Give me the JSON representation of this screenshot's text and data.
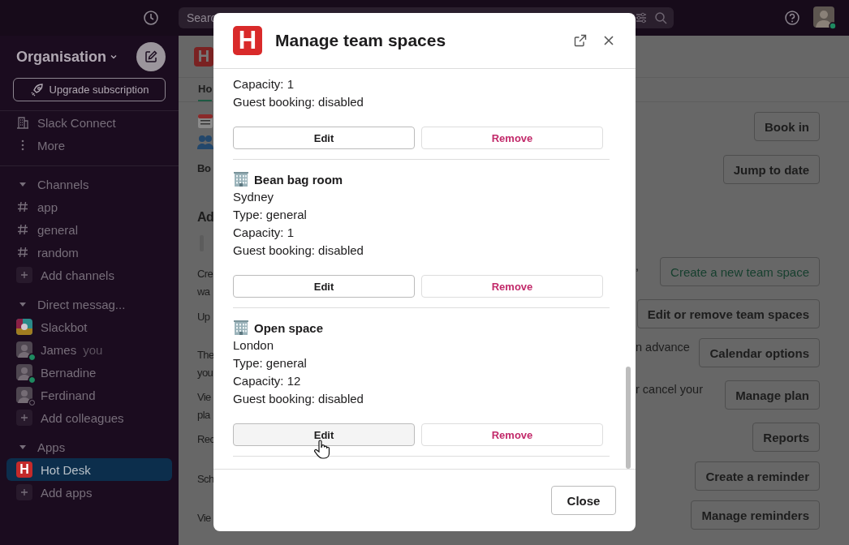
{
  "top_bar": {
    "search": {
      "placeholder": "Searc"
    }
  },
  "sidebar": {
    "workspace": "Organisation",
    "upgrade": "Upgrade subscription",
    "nav": [
      {
        "kind": "connect",
        "label": "Slack Connect"
      },
      {
        "kind": "more",
        "label": "More"
      }
    ],
    "sections": [
      {
        "title": "Channels",
        "expanded": true,
        "items": [
          {
            "kind": "channel",
            "label": "app",
            "selected": false
          },
          {
            "kind": "channel",
            "label": "general",
            "selected": false
          },
          {
            "kind": "channel",
            "label": "random",
            "selected": false
          },
          {
            "kind": "add",
            "label": "Add channels",
            "selected": false
          }
        ]
      },
      {
        "title": "Direct messag...",
        "expanded": true,
        "items": [
          {
            "kind": "bot",
            "label": "Slackbot",
            "selected": false
          },
          {
            "kind": "person",
            "label": "James",
            "note": "you",
            "online": true,
            "selected": false
          },
          {
            "kind": "person",
            "label": "Bernadine",
            "online": true,
            "selected": false
          },
          {
            "kind": "person",
            "label": "Ferdinand",
            "online": false,
            "selected": false
          },
          {
            "kind": "add",
            "label": "Add colleagues",
            "selected": false
          }
        ]
      },
      {
        "title": "Apps",
        "expanded": true,
        "items": [
          {
            "kind": "app",
            "label": "Hot Desk",
            "logo": "H",
            "selected": true
          },
          {
            "kind": "add",
            "label": "Add apps",
            "selected": false
          }
        ]
      }
    ]
  },
  "main": {
    "logo": "H",
    "tab": {
      "label": "Ho",
      "selected": true
    },
    "left": [
      {
        "kind": "calendar"
      },
      {
        "kind": "people"
      },
      {
        "kind": "bold",
        "text": "Bo"
      },
      {
        "kind": "heading",
        "text": "Ad"
      },
      {
        "kind": "quote"
      },
      {
        "kind": "text",
        "text": "Cre"
      },
      {
        "kind": "text",
        "text": "wa"
      },
      {
        "kind": "text",
        "text": "Up"
      },
      {
        "kind": "text",
        "text": "The"
      },
      {
        "kind": "text",
        "text": "you"
      },
      {
        "kind": "text",
        "text": "Vie"
      },
      {
        "kind": "text",
        "text": "pla"
      },
      {
        "kind": "text",
        "text": "Rec"
      },
      {
        "kind": "text",
        "text": "Sch"
      },
      {
        "kind": "text",
        "text": "Vie"
      }
    ],
    "right": [
      {
        "button": "Book in",
        "accent": false
      },
      {
        "button": "Jump to date",
        "accent": false
      },
      {
        "text": ",",
        "button": "Create a new team space",
        "accent": true
      },
      {
        "button": "Edit or remove team spaces",
        "accent": false
      },
      {
        "text": "n advance",
        "button": "Calendar options",
        "accent": false
      },
      {
        "text": "r cancel your",
        "button": "Manage plan",
        "accent": false
      },
      {
        "button": "Reports",
        "accent": false
      },
      {
        "button": "Create a reminder",
        "accent": false
      },
      {
        "button": "Manage reminders",
        "accent": false
      }
    ]
  },
  "modal": {
    "logo": "H",
    "title": "Manage team spaces",
    "spaces": [
      {
        "lines": [
          "Capacity: 1",
          "Guest booking: disabled"
        ],
        "edit": "Edit",
        "remove": "Remove",
        "edit_hovered": false
      },
      {
        "name": "Bean bag room",
        "lines": [
          "Sydney",
          "Type: general",
          "Capacity: 1",
          "Guest booking: disabled"
        ],
        "edit": "Edit",
        "remove": "Remove",
        "edit_hovered": false
      },
      {
        "name": "Open space",
        "lines": [
          "London",
          "Type: general",
          "Capacity: 12",
          "Guest booking: disabled"
        ],
        "edit": "Edit",
        "remove": "Remove",
        "edit_hovered": true
      }
    ],
    "close_button": "Close"
  }
}
